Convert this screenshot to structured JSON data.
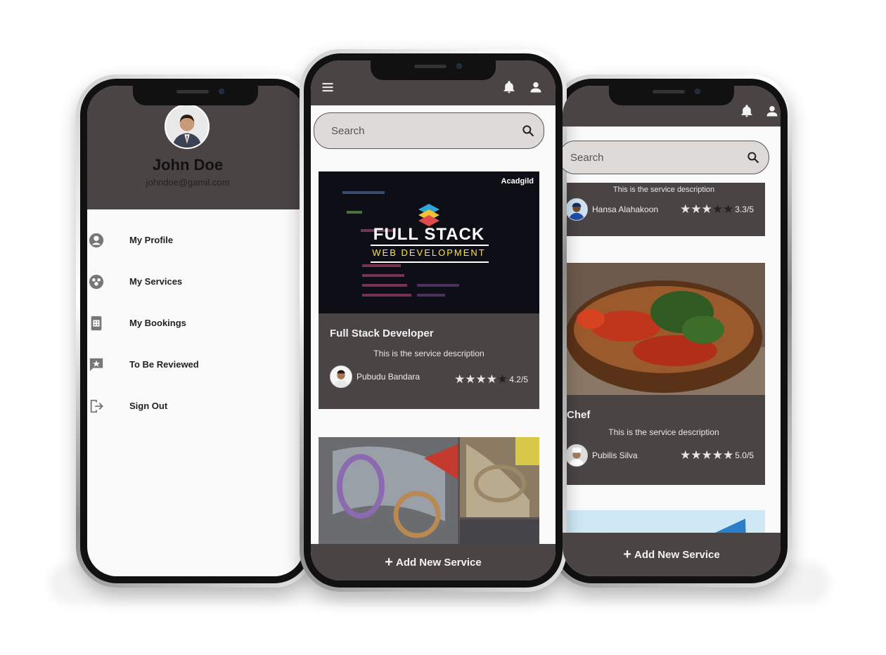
{
  "drawer": {
    "name": "John Doe",
    "email": "johndoe@gamil.com",
    "items": [
      {
        "label": "My Profile",
        "icon": "account-circle-icon"
      },
      {
        "label": "My Services",
        "icon": "group-circle-icon"
      },
      {
        "label": "My Bookings",
        "icon": "booking-calendar-icon"
      },
      {
        "label": "To Be Reviewed",
        "icon": "review-chat-icon"
      },
      {
        "label": "Sign Out",
        "icon": "sign-out-icon"
      }
    ]
  },
  "home": {
    "search_placeholder": "Search",
    "cards": [
      {
        "banner_brand": "Acadgild",
        "banner_title": "FULL STACK",
        "banner_subtitle": "WEB DEVELOPMENT",
        "title": "Full Stack Developer",
        "description": "This is the service description",
        "provider": "Pubudu Bandara",
        "rating": "4.2/5"
      }
    ],
    "add_button": "Add New Service"
  },
  "list": {
    "search_placeholder": "Search",
    "cards": [
      {
        "description": "This is the service description",
        "provider": "Hansa Alahakoon",
        "rating": "3.3/5"
      },
      {
        "title": "Chef",
        "description": "This is the service description",
        "provider": "Pubilis Silva",
        "rating": "5.0/5"
      }
    ],
    "add_button": "Add New Service"
  },
  "colors": {
    "appbar": "#4a4444",
    "search_bg": "#dedad8",
    "banner_accent": "#ffe23a"
  }
}
